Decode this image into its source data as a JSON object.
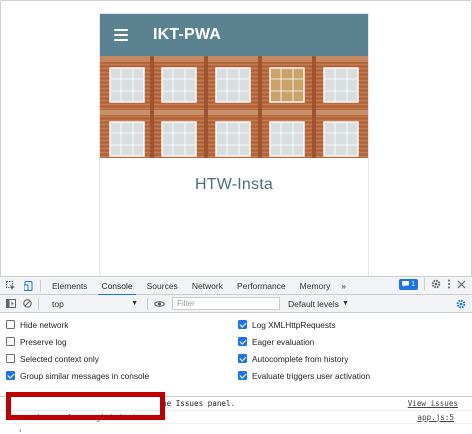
{
  "app": {
    "title": "IKT-PWA",
    "heading": "HTW-Insta"
  },
  "devtools": {
    "tabs": [
      "Elements",
      "Console",
      "Sources",
      "Network",
      "Performance",
      "Memory"
    ],
    "active_tab": "Console",
    "more_tabs": "»",
    "issues_badge": "1",
    "context": "top",
    "filter_placeholder": "Filter",
    "levels": "Default levels",
    "settings_left": [
      {
        "label": "Hide network",
        "checked": false
      },
      {
        "label": "Preserve log",
        "checked": false
      },
      {
        "label": "Selected context only",
        "checked": false
      },
      {
        "label": "Group similar messages in console",
        "checked": true
      }
    ],
    "settings_right": [
      {
        "label": "Log XMLHttpRequests",
        "checked": true
      },
      {
        "label": "Eager evaluation",
        "checked": true
      },
      {
        "label": "Autocomplete from history",
        "checked": true
      },
      {
        "label": "Evaluate triggers user activation",
        "checked": true
      }
    ],
    "messages": [
      {
        "text": "he Issues panel.",
        "link": "View issues"
      },
      {
        "text": "service worker registriert",
        "link": "app.js:5"
      }
    ],
    "prompt": "›"
  },
  "colors": {
    "header": "#5b8290",
    "accent": "#1a73e8",
    "highlight": "#c00000"
  }
}
